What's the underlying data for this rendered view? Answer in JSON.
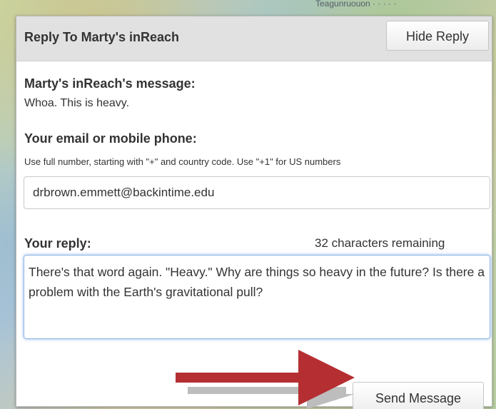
{
  "map": {
    "top_label": "Teagunruouon · · · · ·"
  },
  "panel": {
    "title": "Reply To Marty's inReach",
    "hide_button": "Hide Reply"
  },
  "message": {
    "label": "Marty's inReach's message:",
    "text": "Whoa. This is heavy."
  },
  "contact": {
    "label": "Your email or mobile phone:",
    "hint": "Use full number, starting with \"+\" and country code. Use \"+1\" for US numbers",
    "value": "drbrown.emmett@backintime.edu"
  },
  "reply": {
    "label": "Your reply:",
    "remaining": "32 characters remaining",
    "text": "There's that word again. \"Heavy.\" Why are things so heavy in the future? Is there a problem with the Earth's gravitational pull?"
  },
  "send_button": "Send Message",
  "colors": {
    "arrow": "#b52f32",
    "shadow": "#bdbdbd",
    "focus_border": "#8fb6e6"
  }
}
